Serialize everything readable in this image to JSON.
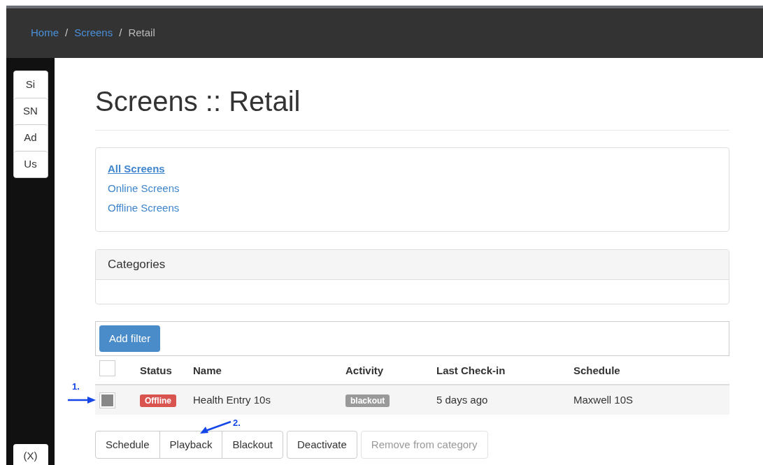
{
  "breadcrumb": [
    {
      "label": "Home",
      "kind": "link"
    },
    {
      "label": "Screens",
      "kind": "link"
    },
    {
      "label": "Retail",
      "kind": "current"
    }
  ],
  "breadcrumb_separator": "/",
  "sidebar": {
    "items": [
      "Si",
      "SN",
      "Ad",
      "Us"
    ],
    "bottom_button": "(X)"
  },
  "title": "Screens :: Retail",
  "screen_filters": [
    {
      "label": "All Screens",
      "selected": true
    },
    {
      "label": "Online Screens",
      "selected": false
    },
    {
      "label": "Offline Screens",
      "selected": false
    }
  ],
  "categories": {
    "title": "Categories"
  },
  "add_filter": "Add filter",
  "table": {
    "columns": [
      "Status",
      "Name",
      "Activity",
      "Last Check-in",
      "Schedule"
    ],
    "all_checked": false,
    "rows": [
      {
        "checked": true,
        "status": "Offline",
        "name": "Health Entry 10s",
        "activity": "blackout",
        "last_check_in": "5 days ago",
        "schedule": "Maxwell 10S"
      }
    ]
  },
  "action_groups": [
    [
      {
        "label": "Schedule",
        "disabled": false
      },
      {
        "label": "Playback",
        "disabled": false
      },
      {
        "label": "Blackout",
        "disabled": false
      }
    ],
    [
      {
        "label": "Deactivate",
        "disabled": false
      }
    ],
    [
      {
        "label": "Remove from category",
        "disabled": true
      }
    ]
  ],
  "annotations": [
    "1.",
    "2."
  ]
}
